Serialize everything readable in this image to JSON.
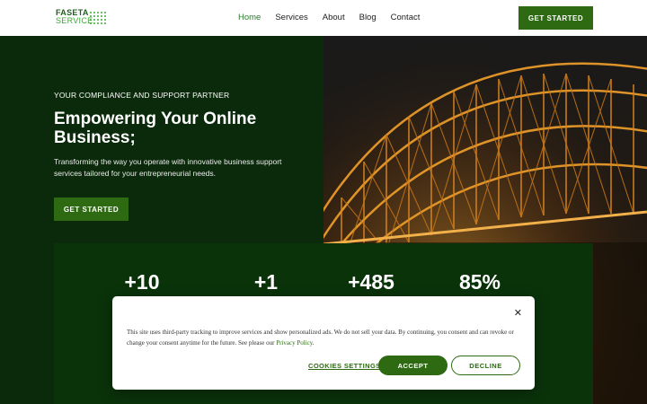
{
  "header": {
    "logo_line1": "FASETA",
    "logo_line2": "SERVICE",
    "nav": [
      "Home",
      "Services",
      "About",
      "Blog",
      "Contact"
    ],
    "active_nav": "Home",
    "cta": "GET STARTED"
  },
  "hero": {
    "eyebrow": "YOUR COMPLIANCE AND SUPPORT PARTNER",
    "title": "Empowering Your Online Business;",
    "description": "Transforming the way you operate with innovative business support services tailored for your entrepreneurial needs.",
    "cta": "GET STARTED"
  },
  "stats": [
    "+10",
    "+1",
    "+485",
    "85%"
  ],
  "cookie": {
    "text_before_link": "This site uses third-party tracking to improve services and show personalized ads. We do not sell your data. By continuing, you consent and can revoke or change your consent anytime for the future. See please our ",
    "link": "Privacy Policy",
    "text_after_link": ".",
    "settings": "COOKIES SETTINGS",
    "accept": "ACCEPT",
    "decline": "DECLINE",
    "close": "✕"
  },
  "colors": {
    "brand_green": "#2d6a12",
    "dark_bg": "#0b2a0b",
    "stats_bg": "#0a330a"
  }
}
